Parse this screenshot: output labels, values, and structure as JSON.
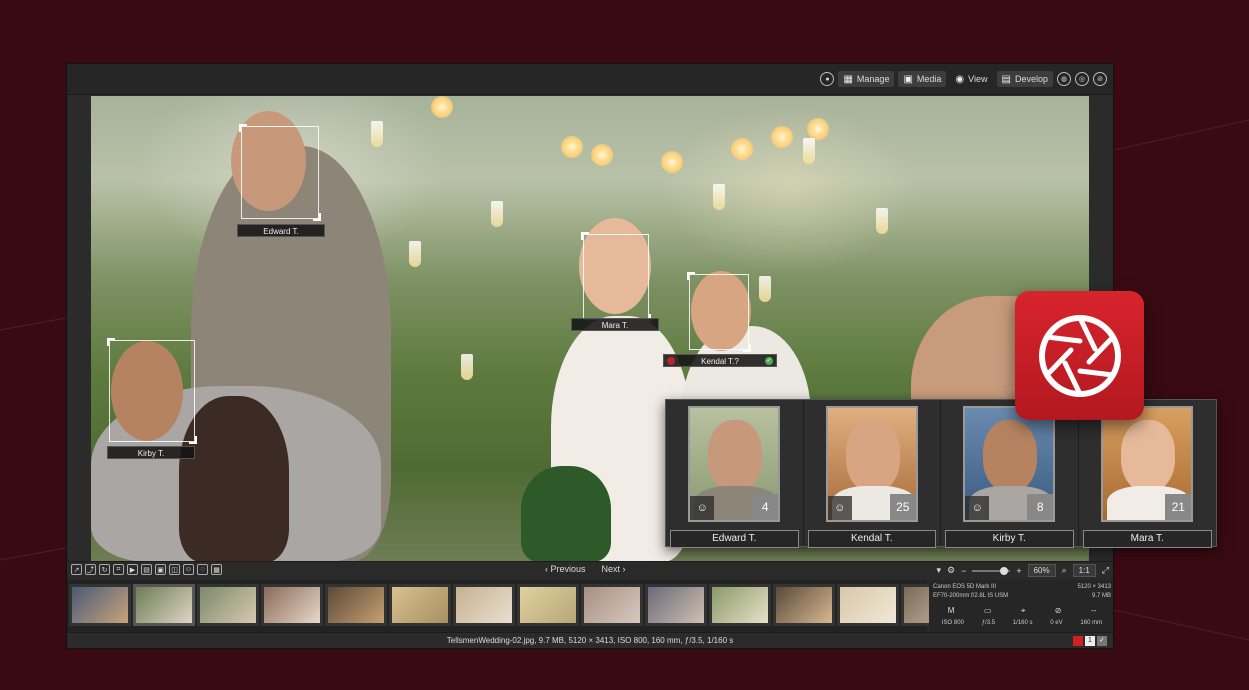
{
  "colors": {
    "background": "#3a0a12",
    "window": "#2b2b2b",
    "logo": "#d8242c",
    "reject": "#c0202a",
    "accept": "#4caf50"
  },
  "topbar": {
    "modes": [
      {
        "label": "Manage",
        "icon": "grid-icon"
      },
      {
        "label": "Media",
        "icon": "media-icon"
      },
      {
        "label": "View",
        "icon": "eye-icon"
      },
      {
        "label": "Develop",
        "icon": "develop-icon"
      }
    ]
  },
  "face_tags": [
    "Edward T.",
    "Mara T.",
    "Kendal T.?",
    "Kirby T."
  ],
  "toolbar": {
    "previous": "Previous",
    "next": "Next",
    "zoom": "60%",
    "actual": "1:1"
  },
  "info": {
    "camera": "Canon EOS 5D Mark III",
    "dimensions": "5120 × 3413",
    "lens": "EF70-200mm f/2.8L IS USM",
    "size": "9.7 MB",
    "mode": "M",
    "dash": "--",
    "iso": "ISO 800",
    "aperture": "ƒ/3.5",
    "shutter": "1/160 s",
    "ev": "0 eV",
    "focal": "160 mm"
  },
  "status": {
    "text": "TellsmenWedding-02.jpg, 9.7 MB, 5120 × 3413, ISO 800, 160 mm, ƒ/3.5, 1/160 s",
    "rating": "1"
  },
  "people": [
    {
      "name": "Edward T.",
      "count": "4"
    },
    {
      "name": "Kendal T.",
      "count": "25"
    },
    {
      "name": "Kirby T.",
      "count": "8"
    },
    {
      "name": "Mara T.",
      "count": "21"
    }
  ]
}
